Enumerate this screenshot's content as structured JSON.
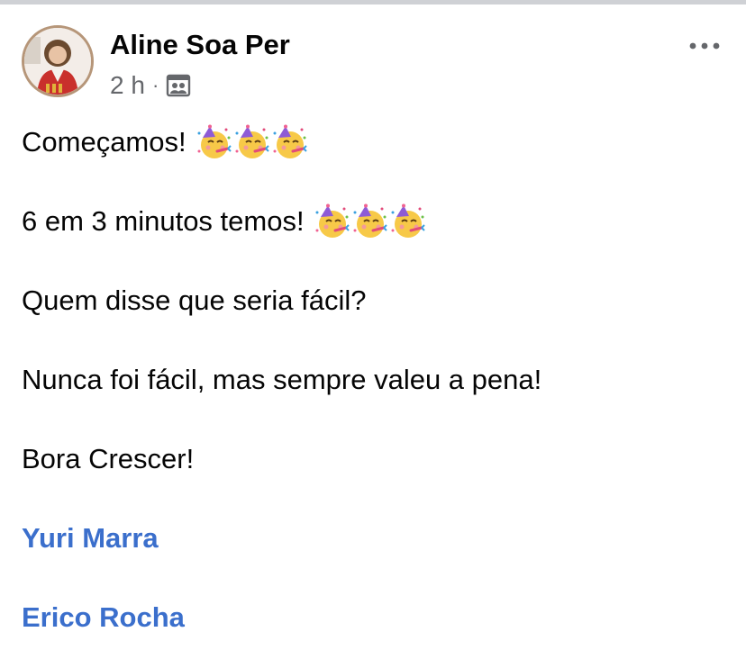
{
  "post": {
    "author": "Aline Soa Per",
    "time": "2 h",
    "separator": "·",
    "audience_icon": "group-audience-icon",
    "more_icon": "more-options-icon",
    "lines": [
      {
        "text": "Começamos!",
        "emoji": "partying-face",
        "emoji_count": 3
      },
      {
        "text": "6 em 3 minutos temos!",
        "emoji": "partying-face",
        "emoji_count": 3
      },
      {
        "text": "Quem disse que seria fácil?"
      },
      {
        "text": "Nunca foi fácil, mas sempre valeu a pena!"
      },
      {
        "text": "Bora Crescer!"
      }
    ],
    "tags": [
      "Yuri Marra",
      "Erico Rocha"
    ]
  },
  "colors": {
    "tag_link": "#3b6fcc",
    "meta_text": "#65676b",
    "avatar_ring": "#b69679"
  }
}
